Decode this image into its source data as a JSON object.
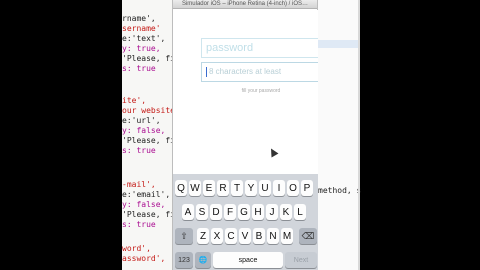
{
  "simulator": {
    "title": "Simulador iOS – iPhone Retina (4-inch) / iOS…"
  },
  "code_left": {
    "lines": [
      "rname',",
      "sername'",
      "e:'text',",
      "y: true,",
      "'Please, fill",
      "s: true",
      "ite',",
      "our website'",
      "e:'url',",
      "y: false,",
      "'Please, fil",
      "s: true",
      "-mail',",
      "e:'email',",
      "y: false,",
      "'Please, fil",
      "s: true",
      "word',",
      "assword',"
    ]
  },
  "code_right": {
    "text": "method, s"
  },
  "form": {
    "password_placeholder": "password",
    "confirm_placeholder": "8 characters at least",
    "hint": "fill your password"
  },
  "keyboard": {
    "row1": [
      "Q",
      "W",
      "E",
      "R",
      "T",
      "Y",
      "U",
      "I",
      "O",
      "P"
    ],
    "row2": [
      "A",
      "S",
      "D",
      "F",
      "G",
      "H",
      "J",
      "K",
      "L"
    ],
    "row3": [
      "Z",
      "X",
      "C",
      "V",
      "B",
      "N",
      "M"
    ],
    "shift": "⇧",
    "delete": "⌫",
    "numbers": "123",
    "globe": "🌐",
    "space": "space",
    "next": "Next"
  },
  "colors": {
    "field_border": "#cfe6ee",
    "keyboard_bg": "#d1d5db"
  }
}
